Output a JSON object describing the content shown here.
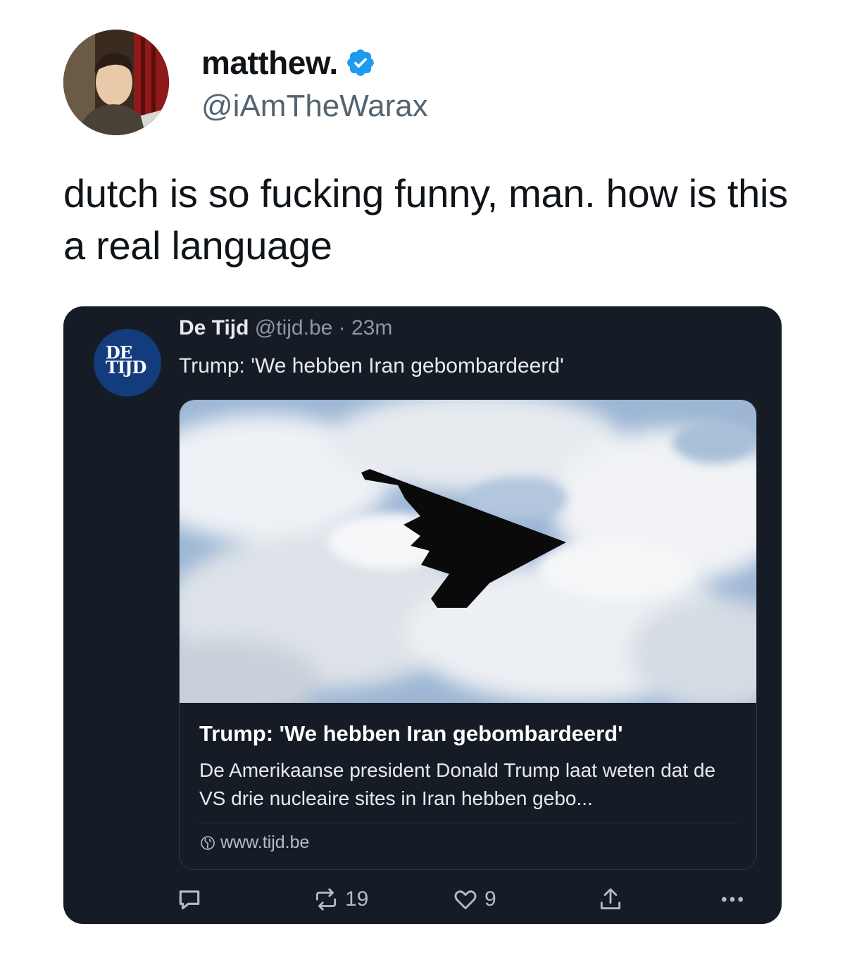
{
  "tweet": {
    "display_name": "matthew.",
    "handle": "@iAmTheWarax",
    "text": "dutch is so fucking funny, man. how is this a real language",
    "verified_color": "#1d9bf0"
  },
  "quoted_post": {
    "avatar_text_top": "DE",
    "avatar_text_bottom": "TIJD",
    "name": "De Tijd",
    "meta": " @tijd.be · 23m",
    "text": "Trump: 'We hebben Iran gebombardeerd'",
    "card": {
      "title": "Trump: 'We hebben Iran gebombardeerd'",
      "description": "De Amerikaanse president Donald Trump laat weten dat de VS drie nucleaire sites in Iran hebben gebo...",
      "link": "www.tijd.be"
    },
    "actions": {
      "reply_icon": "reply-icon",
      "repost_icon": "repost-icon",
      "repost_count": "19",
      "like_icon": "heart-icon",
      "like_count": "9",
      "share_icon": "share-icon",
      "more_icon": "more-icon"
    }
  },
  "colors": {
    "quote_bg": "#161c26",
    "avatar_bg": "#133c7d",
    "muted": "#536471"
  }
}
